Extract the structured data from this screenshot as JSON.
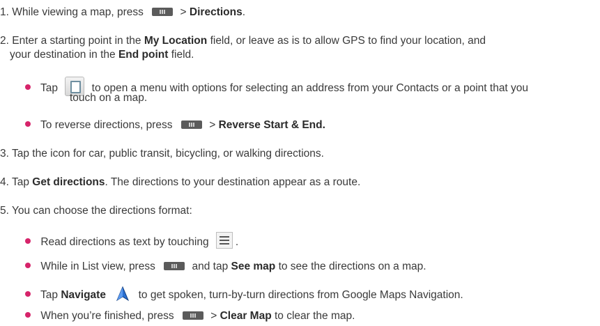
{
  "steps": [
    {
      "num": "1.",
      "pre": "While viewing a map, press",
      "gt": ">",
      "bold": "Directions",
      "post": "."
    },
    {
      "num": "2.",
      "line1_pre": "Enter a starting point in the",
      "b1": "My Location",
      "line1_post": "field, or leave as is to allow GPS to find your location, and",
      "line2_pre": "your destination in the",
      "b2": "End point",
      "line2_post": "field."
    },
    {
      "num": "3.",
      "text": "Tap the icon for car, public transit, bicycling, or walking directions."
    },
    {
      "num": "4.",
      "pre": "Tap",
      "bold": "Get directions",
      "post": ". The directions to your destination appear as a route."
    },
    {
      "num": "5.",
      "text": "You can choose the directions format:"
    }
  ],
  "bullets_step2": [
    {
      "pre": "Tap",
      "line1_post": "to open a menu with options for selecting an address from your Contacts or a point that you",
      "line2": "touch on a map."
    },
    {
      "pre": "To reverse directions, press",
      "gt": ">",
      "bold": "Reverse Start & End."
    }
  ],
  "bullets_step5": [
    {
      "pre": "Read directions as text by touching",
      "post": "."
    },
    {
      "pre": "While in List view, press",
      "mid": "and tap",
      "bold": "See map",
      "post": "to see the directions on a map."
    },
    {
      "pre": "Tap",
      "bold": "Navigate",
      "post": "to get spoken, turn-by-turn directions from Google Maps Navigation."
    },
    {
      "pre": "When you’re finished, press",
      "gt": ">",
      "bold": "Clear Map",
      "post": "to clear the map."
    }
  ],
  "colors": {
    "bullet": "#d6246a",
    "nav_icon": "#2a6fd1"
  },
  "icons": [
    "menu-key-icon",
    "contacts-icon",
    "list-view-icon",
    "navigate-icon"
  ]
}
